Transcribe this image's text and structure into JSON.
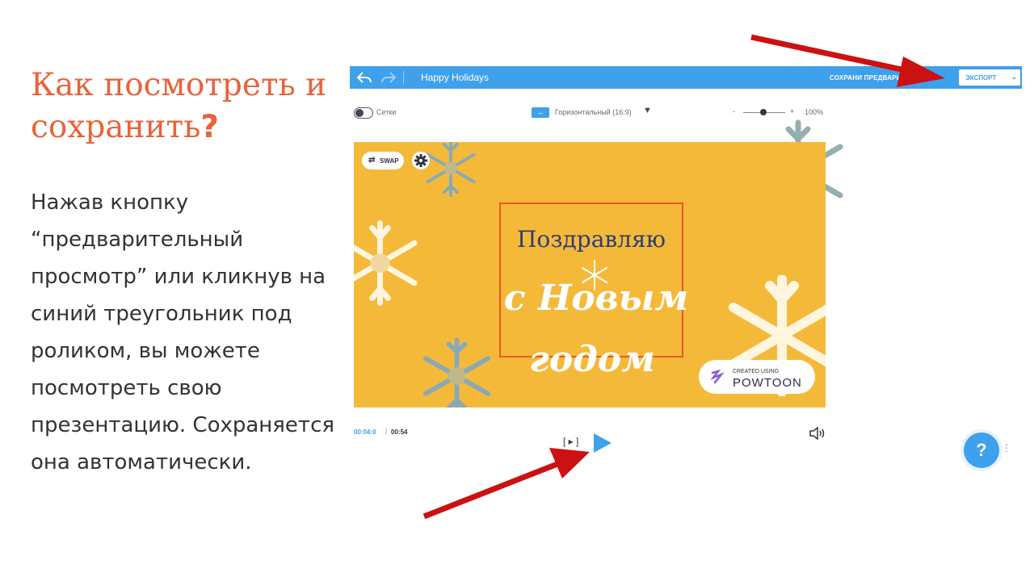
{
  "slide": {
    "title": "Как посмотреть и сохранить",
    "title_mark": "?",
    "body": "Нажав кнопку “предварительный просмотр” или кликнув на синий треугольник под роликом, вы можете посмотреть свою презентацию. Сохраняется она автоматически."
  },
  "editor": {
    "project_name": "Happy Holidays",
    "header_links": "СОХРАНИ ПРЕДВАРИТЕЛЬНЫЙ",
    "export_label": "ЭКСПОРТ",
    "grid_label": "Сетки",
    "orientation_label": "Горизонтальный (16:9)",
    "zoom_minus": "-",
    "zoom_plus": "+",
    "zoom_level": "100%",
    "swap_label": "SWAP",
    "greeting_line1": "Поздравляю",
    "greeting_line2": "с Новым",
    "greeting_line3": "годом",
    "watermark_small": "CREATED USING",
    "watermark_brand": "POWTOON",
    "time_current": "00:04:0",
    "time_total": "00:54",
    "preview_button": "[ ▸ ]",
    "help_label": "?",
    "menu_dots": "⋮"
  },
  "icons": [
    "undo-icon",
    "redo-icon",
    "chevron-down-icon",
    "grid-toggle",
    "orientation-icon",
    "swap-icon",
    "gear-icon",
    "snowflake-icon",
    "powtoon-logo-icon",
    "play-icon",
    "speaker-icon",
    "help-icon",
    "arrow-annotation"
  ],
  "colors": {
    "accent": "#3fa0ec",
    "title": "#e8633a",
    "canvas": "#f5b93a",
    "annotation_arrow": "#cc1111"
  }
}
